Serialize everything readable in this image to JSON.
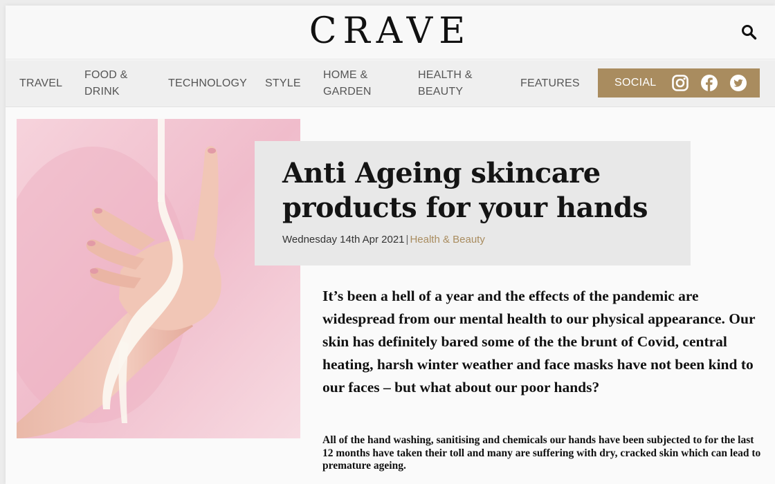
{
  "site": {
    "logo_text": "CRAVE",
    "search_icon": "search-icon"
  },
  "nav": {
    "items": [
      {
        "line1": "TRAVEL",
        "line2": ""
      },
      {
        "line1": "FOOD &",
        "line2": "DRINK"
      },
      {
        "line1": "TECHNOLOGY",
        "line2": ""
      },
      {
        "line1": "STYLE",
        "line2": ""
      },
      {
        "line1": "HOME &",
        "line2": "GARDEN"
      },
      {
        "line1": "HEALTH &",
        "line2": "BEAUTY"
      },
      {
        "line1": "FEATURES",
        "line2": ""
      }
    ],
    "social": {
      "label": "SOCIAL",
      "icons": [
        "instagram-icon",
        "facebook-icon",
        "twitter-icon"
      ]
    }
  },
  "article": {
    "title_line1": "Anti Ageing skincare",
    "title_line2": "products for your hands",
    "date": "Wednesday 14th Apr 2021",
    "separator": "|",
    "category": "Health & Beauty",
    "lead": "It’s been a hell of a year and the effects of the pandemic are widespread from our mental health to our physical appearance. Our skin has definitely bared some of the the brunt of Covid, central heating, harsh winter weather and face masks have not been kind to our faces – but what about our poor hands?",
    "body": "All of the hand washing, sanitising and chemicals our hands have been subjected to for the last 12 months have taken their toll and many are suffering with dry, cracked skin which can lead to premature ageing."
  },
  "colors": {
    "accent": "#a98c5f",
    "hero_pink": "#f2c9d4"
  }
}
